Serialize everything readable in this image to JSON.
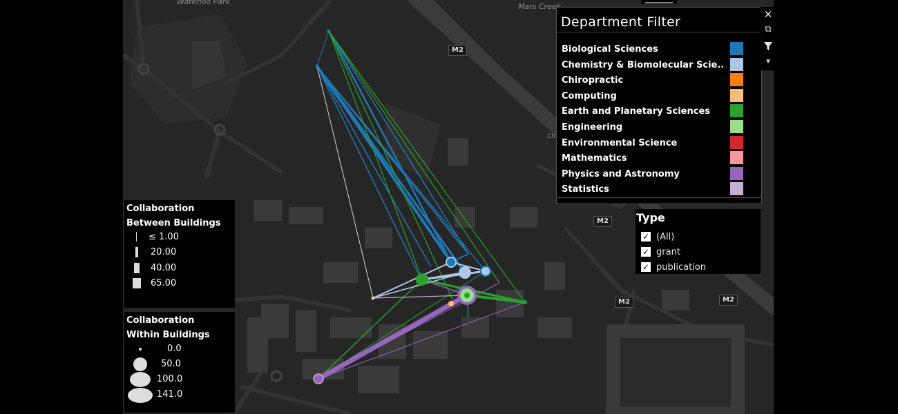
{
  "map": {
    "labels": {
      "park": "Waterloo Park",
      "creek": "Mars Creek",
      "cut": "Ch"
    },
    "shields": [
      "M2",
      "M2",
      "M2",
      "M2"
    ]
  },
  "department_filter": {
    "title": "Department Filter",
    "items": [
      {
        "label": "Biological Sciences",
        "color": "#1f77b4"
      },
      {
        "label": "Chemistry & Biomolecular Scie..",
        "color": "#aec7e8"
      },
      {
        "label": "Chiropractic",
        "color": "#ff7f0e"
      },
      {
        "label": "Computing",
        "color": "#ffbb78"
      },
      {
        "label": "Earth and Planetary Sciences",
        "color": "#2ca02c"
      },
      {
        "label": "Engineering",
        "color": "#98df8a"
      },
      {
        "label": "Environmental Science",
        "color": "#d62728"
      },
      {
        "label": "Mathematics",
        "color": "#ff9896"
      },
      {
        "label": "Physics and Astronomy",
        "color": "#9467bd"
      },
      {
        "label": "Statistics",
        "color": "#c5b0d5"
      }
    ]
  },
  "toolbar": {
    "close": "✕",
    "popout": "⧉",
    "filter": "⏷",
    "menu": "▾"
  },
  "type_filter": {
    "title": "Type",
    "options": [
      {
        "label": "(All)",
        "checked": true
      },
      {
        "label": "grant",
        "checked": true
      },
      {
        "label": "publication",
        "checked": true
      }
    ]
  },
  "legend_between": {
    "title_line1": "Collaboration",
    "title_line2": "Between Buildings",
    "items": [
      "≤ 1.00",
      "20.00",
      "40.00",
      "65.00"
    ]
  },
  "legend_within": {
    "title_line1": "Collaboration",
    "title_line2": "Within Buildings",
    "items": [
      "0.0",
      "50.0",
      "100.0",
      "141.0"
    ]
  }
}
